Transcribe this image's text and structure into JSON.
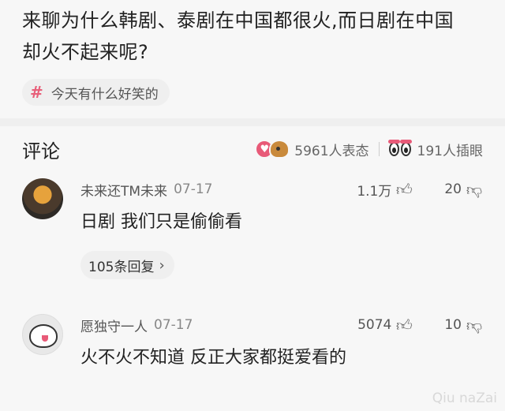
{
  "post": {
    "title_line1": "来聊为什么韩剧、泰剧在中国都很火,而日剧在中国",
    "title_line2": "却火不起来呢?",
    "topic_tag": "今天有什么好笑的"
  },
  "comments_header": {
    "title": "评论",
    "reaction_count": "5961人表态",
    "insert_count": "191人插眼"
  },
  "comments": [
    {
      "username": "未来还TM未来",
      "date": "07-17",
      "likes": "1.1万",
      "dislikes": "20",
      "text": "日剧 我们只是偷偷看",
      "replies": "105条回复"
    },
    {
      "username": "愿独守一人",
      "date": "07-17",
      "likes": "5074",
      "dislikes": "10",
      "text": "火不火不知道 反正大家都挺爱看的"
    }
  ],
  "watermark": "Qiu naZai",
  "colors": {
    "accent": "#e85a78",
    "background": "#f7f7f7"
  },
  "icons": {
    "topic": "hash-icon",
    "like": "thumbs-up-icon",
    "dislike": "thumbs-down-icon",
    "reaction": "heart-doge-icon",
    "insert_eye": "eyes-icon",
    "chevron": "chevron-right-icon"
  }
}
